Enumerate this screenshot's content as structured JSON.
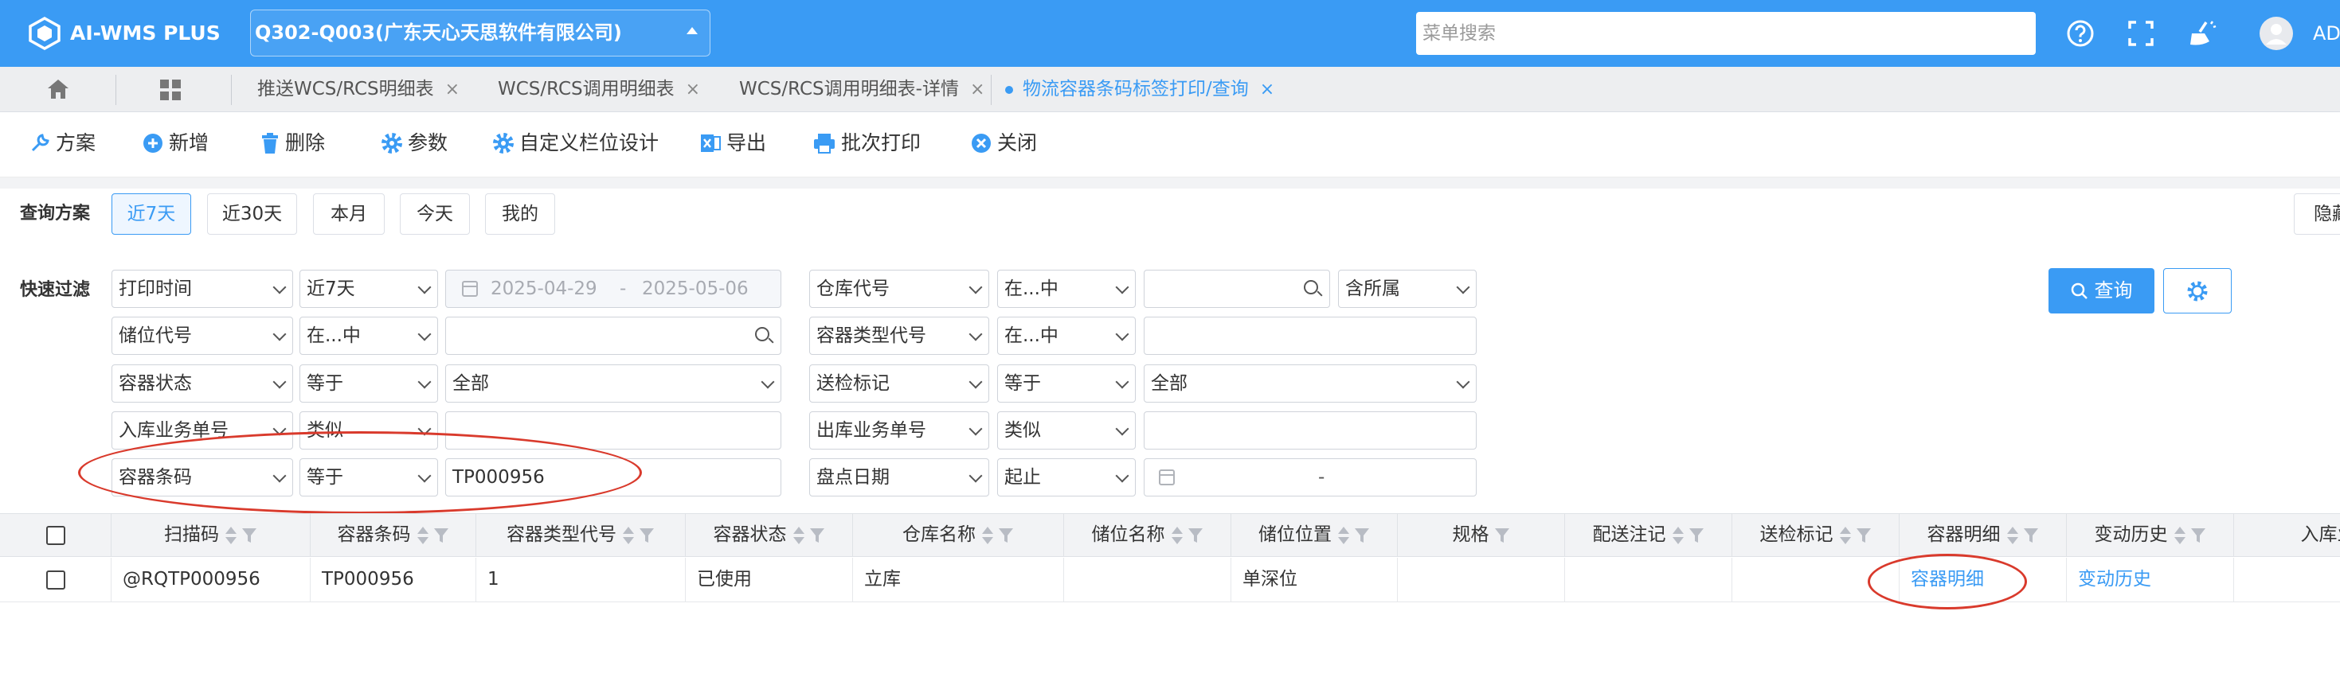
{
  "app": {
    "brand": "AI-WMS PLUS",
    "org": "Q302-Q003(广东天心天思软件有限公司)",
    "menu_search_placeholder": "菜单搜索",
    "user": "AD",
    "accent": "#3a9bf4",
    "highlight": "#d93a2c"
  },
  "icons": {
    "logo": "box-logo-icon",
    "help": "help-circle-icon",
    "fullscreen": "fullscreen-icon",
    "clean": "broom-icon",
    "avatar": "user-avatar-icon"
  },
  "tabs": [
    {
      "label": "推送WCS/RCS明细表",
      "close": "×"
    },
    {
      "label": "WCS/RCS调用明细表",
      "close": "×"
    },
    {
      "label": "WCS/RCS调用明细表-详情",
      "close": "×"
    },
    {
      "label": "物流容器条码标签打印/查询",
      "close": "×",
      "active": true
    }
  ],
  "toolbar": [
    "方案",
    "新增",
    "删除",
    "参数",
    "自定义栏位设计",
    "导出",
    "批次打印",
    "关闭"
  ],
  "query": {
    "label": "查询方案",
    "presets": [
      "近7天",
      "近30天",
      "本月",
      "今天",
      "我的"
    ],
    "active": "近7天",
    "hide": "隐藏"
  },
  "filter": {
    "label": "快速过滤",
    "left": [
      {
        "field": "打印时间",
        "op": "近7天",
        "from": "2025-04-29",
        "sep": "-",
        "to": "2025-05-06"
      },
      {
        "field": "储位代号",
        "op": "在...中",
        "value": ""
      },
      {
        "field": "容器状态",
        "op": "等于",
        "value": "全部"
      },
      {
        "field": "入库业务单号",
        "op": "类似",
        "value": ""
      },
      {
        "field": "容器条码",
        "op": "等于",
        "value": "TP000956"
      }
    ],
    "right": [
      {
        "field": "仓库代号",
        "op": "在...中",
        "value": "",
        "extra": "含所属"
      },
      {
        "field": "容器类型代号",
        "op": "在...中",
        "value": ""
      },
      {
        "field": "送检标记",
        "op": "等于",
        "value": "全部"
      },
      {
        "field": "出库业务单号",
        "op": "类似",
        "value": ""
      },
      {
        "field": "盘点日期",
        "op": "起止",
        "sep": "-"
      }
    ],
    "search": "查询"
  },
  "table": {
    "columns": [
      "扫描码",
      "容器条码",
      "容器类型代号",
      "容器状态",
      "仓库名称",
      "储位名称",
      "储位位置",
      "规格",
      "配送注记",
      "送检标记",
      "容器明细",
      "变动历史",
      "入库业务"
    ],
    "rows": [
      [
        "@RQTP000956",
        "TP000956",
        "1",
        "已使用",
        "立库",
        "",
        "单深位",
        "",
        "",
        "",
        "容器明细",
        "变动历史",
        ""
      ]
    ]
  }
}
